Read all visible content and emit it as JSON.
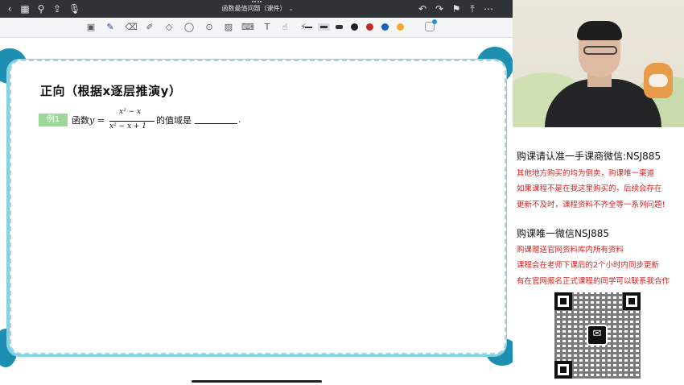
{
  "app": {
    "title": "函数最值问题（课件）"
  },
  "topbar": {
    "icons": [
      "back-icon",
      "grid-icon",
      "search-icon",
      "share-icon",
      "microphone-icon",
      "undo-icon",
      "redo-icon",
      "bookmark-icon",
      "export-icon",
      "more-icon"
    ],
    "title_chevron": "⌄"
  },
  "toolbar": {
    "tools": [
      "text-recognition-icon",
      "pen-icon",
      "eraser-icon",
      "highlighter-icon",
      "shapes-icon",
      "lasso-icon",
      "zoom-icon",
      "image-icon",
      "keyboard-icon",
      "textbox-icon",
      "hand-icon",
      "laser-pointer-icon"
    ],
    "colors": [
      "#222222",
      "#2e7d32",
      "#d32f2f",
      "#1565c0",
      "#f9a825"
    ]
  },
  "slide": {
    "heading": "正向（根据x逐层推演y）",
    "example_badge": "例1",
    "question_prefix": "函数",
    "y_eq": "y =",
    "numerator": "x² − x",
    "denominator": "x² − x + 1",
    "question_suffix": "的值域是",
    "period": "."
  },
  "info": {
    "line1": "购课请认准一手课商微信:NSJ885",
    "line2": "其他地方购买的均为倒卖，购课唯一渠道",
    "line3": "如果课程不是在我这里购买的，后续会存在",
    "line4": "更新不及时，课程资料不齐全等一系列问题!",
    "line5": "购课唯一微信NSJ885",
    "line6": "购课赠送官网资料库内所有资料",
    "line7": "课程会在老师下课后的2个小时内同步更新",
    "line8": "有在官网报名正式课程的同学可以联系我合作"
  }
}
